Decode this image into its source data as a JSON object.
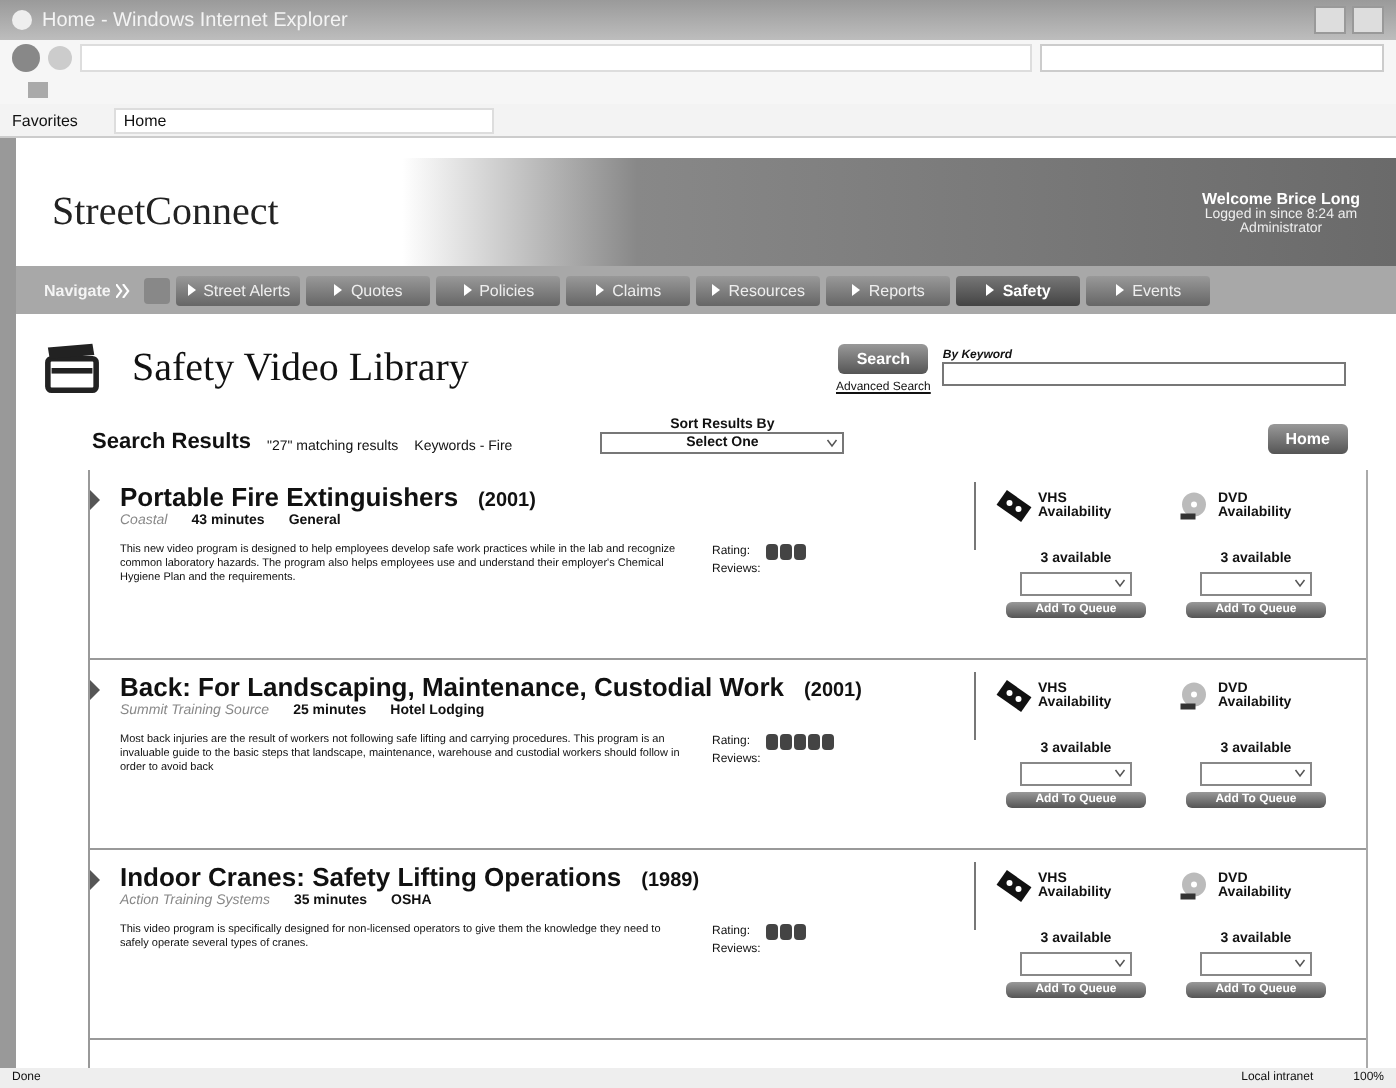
{
  "window": {
    "title": "Home - Windows Internet Explorer"
  },
  "favorites": {
    "label": "Favorites",
    "tab": "Home"
  },
  "header": {
    "logo": "StreetConnect",
    "welcome": "Welcome Brice Long",
    "logged": "Logged in since 8:24 am",
    "role": "Administrator"
  },
  "nav": {
    "label": "Navigate",
    "items": [
      {
        "label": "Street Alerts",
        "selected": false
      },
      {
        "label": "Quotes",
        "selected": false
      },
      {
        "label": "Policies",
        "selected": false
      },
      {
        "label": "Claims",
        "selected": false
      },
      {
        "label": "Resources",
        "selected": false
      },
      {
        "label": "Reports",
        "selected": false
      },
      {
        "label": "Safety",
        "selected": true
      },
      {
        "label": "Events",
        "selected": false
      }
    ]
  },
  "library": {
    "title": "Safety Video Library",
    "search_button": "Search",
    "keyword_label": "By Keyword",
    "advanced": "Advanced Search"
  },
  "results": {
    "title": "Search Results",
    "count": "\"27\" matching results",
    "keywords": "Keywords - Fire",
    "sort_label": "Sort Results By",
    "sort_value": "Select One",
    "home_button": "Home"
  },
  "videos": [
    {
      "title": "Portable Fire Extinguishers",
      "year": "(2001)",
      "source": "Coastal",
      "duration": "43 minutes",
      "category": "General",
      "description": "This new video program is designed to help employees develop safe work practices while in the lab and recognize common laboratory hazards. The program also helps employees use and understand their employer's Chemical Hygiene Plan and the requirements.",
      "rating_label": "Rating:",
      "stars": 3,
      "reviews_label": "Reviews:",
      "vhs": {
        "label": "VHS",
        "sub": "Availability",
        "available": "3 available",
        "button": "Add To Queue"
      },
      "dvd": {
        "label": "DVD",
        "sub": "Availability",
        "available": "3 available",
        "button": "Add To Queue"
      }
    },
    {
      "title": "Back: For Landscaping, Maintenance, Custodial Work",
      "year": "(2001)",
      "source": "Summit Training Source",
      "duration": "25 minutes",
      "category": "Hotel Lodging",
      "description": "Most back injuries are the result of workers not following safe lifting and carrying procedures. This program is an invaluable guide to the basic steps that landscape, maintenance, warehouse and custodial workers should follow in order to avoid back",
      "rating_label": "Rating:",
      "stars": 5,
      "reviews_label": "Reviews:",
      "vhs": {
        "label": "VHS",
        "sub": "Availability",
        "available": "3 available",
        "button": "Add To Queue"
      },
      "dvd": {
        "label": "DVD",
        "sub": "Availability",
        "available": "3 available",
        "button": "Add To Queue"
      }
    },
    {
      "title": "Indoor Cranes: Safety Lifting Operations",
      "year": "(1989)",
      "source": "Action Training Systems",
      "duration": "35 minutes",
      "category": "OSHA",
      "description": "This video program is specifically designed for non-licensed operators to give them the knowledge they need to safely operate several types of cranes.",
      "rating_label": "Rating:",
      "stars": 3,
      "reviews_label": "Reviews:",
      "vhs": {
        "label": "VHS",
        "sub": "Availability",
        "available": "3 available",
        "button": "Add To Queue"
      },
      "dvd": {
        "label": "DVD",
        "sub": "Availability",
        "available": "3 available",
        "button": "Add To Queue"
      }
    }
  ],
  "status_bar": {
    "left": "Done",
    "zone": "Local intranet",
    "zoom": "100%"
  }
}
